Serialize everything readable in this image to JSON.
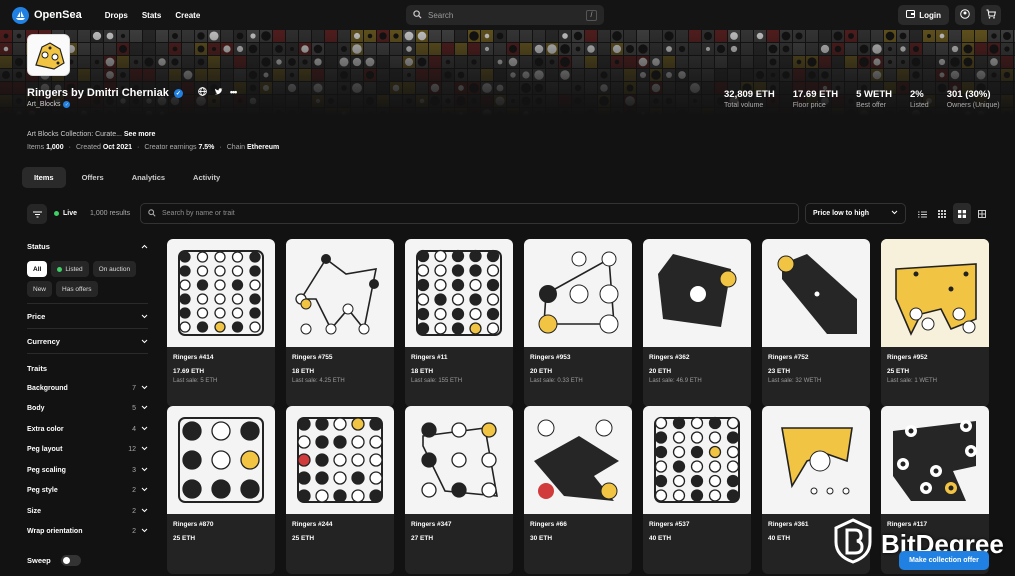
{
  "nav": {
    "brand": "OpenSea",
    "links": [
      "Drops",
      "Stats",
      "Create"
    ],
    "search_placeholder": "Search",
    "search_key": "/",
    "login": "Login"
  },
  "collection": {
    "name": "Ringers by Dmitri Cherniak",
    "creator": "Art_Blocks",
    "description_text": "Art Blocks Collection: Curate...",
    "see_more": "See more"
  },
  "meta": {
    "items_label": "Items",
    "items_value": "1,000",
    "created_label": "Created",
    "created_value": "Oct 2021",
    "earnings_label": "Creator earnings",
    "earnings_value": "7.5%",
    "chain_label": "Chain",
    "chain_value": "Ethereum"
  },
  "stats": [
    {
      "value": "32,809 ETH",
      "label": "Total volume"
    },
    {
      "value": "17.69 ETH",
      "label": "Floor price"
    },
    {
      "value": "5 WETH",
      "label": "Best offer"
    },
    {
      "value": "2%",
      "label": "Listed"
    },
    {
      "value": "301 (30%)",
      "label": "Owners (Unique)"
    }
  ],
  "tabs": [
    "Items",
    "Offers",
    "Analytics",
    "Activity"
  ],
  "toolbar": {
    "live": "Live",
    "results": "1,000 results",
    "search_placeholder": "Search by name or trait",
    "sort": "Price low to high"
  },
  "sidebar": {
    "status_title": "Status",
    "status_pills": [
      "All",
      "Listed",
      "On auction",
      "New",
      "Has offers"
    ],
    "price": "Price",
    "currency": "Currency",
    "traits_title": "Traits",
    "traits": [
      {
        "name": "Background",
        "count": "7"
      },
      {
        "name": "Body",
        "count": "5"
      },
      {
        "name": "Extra color",
        "count": "4"
      },
      {
        "name": "Peg layout",
        "count": "12"
      },
      {
        "name": "Peg scaling",
        "count": "3"
      },
      {
        "name": "Peg style",
        "count": "2"
      },
      {
        "name": "Size",
        "count": "2"
      },
      {
        "name": "Wrap orientation",
        "count": "2"
      }
    ],
    "sweep": "Sweep"
  },
  "cards": [
    {
      "name": "Ringers #414",
      "price": "17.69 ETH",
      "last": "Last sale: 5 ETH"
    },
    {
      "name": "Ringers #755",
      "price": "18 ETH",
      "last": "Last sale: 4.25 ETH"
    },
    {
      "name": "Ringers #11",
      "price": "18 ETH",
      "last": "Last sale: 155 ETH"
    },
    {
      "name": "Ringers #953",
      "price": "20 ETH",
      "last": "Last sale: 0.33 ETH"
    },
    {
      "name": "Ringers #362",
      "price": "20 ETH",
      "last": "Last sale: 46.9 ETH"
    },
    {
      "name": "Ringers #752",
      "price": "23 ETH",
      "last": "Last sale: 32 WETH"
    },
    {
      "name": "Ringers #952",
      "price": "25 ETH",
      "last": "Last sale: 1 WETH"
    },
    {
      "name": "Ringers #870",
      "price": "25 ETH",
      "last": ""
    },
    {
      "name": "Ringers #244",
      "price": "25 ETH",
      "last": ""
    },
    {
      "name": "Ringers #347",
      "price": "27 ETH",
      "last": ""
    },
    {
      "name": "Ringers #66",
      "price": "30 ETH",
      "last": ""
    },
    {
      "name": "Ringers #537",
      "price": "40 ETH",
      "last": ""
    },
    {
      "name": "Ringers #361",
      "price": "40 ETH",
      "last": ""
    },
    {
      "name": "Ringers #117",
      "price": "",
      "last": ""
    }
  ],
  "offer_button": "Make collection offer",
  "watermark": "BitDegree",
  "colors": {
    "accent": "#2081e2",
    "live": "#3ecf66",
    "peg_yellow": "#f2c443",
    "peg_red": "#d23b3b"
  }
}
